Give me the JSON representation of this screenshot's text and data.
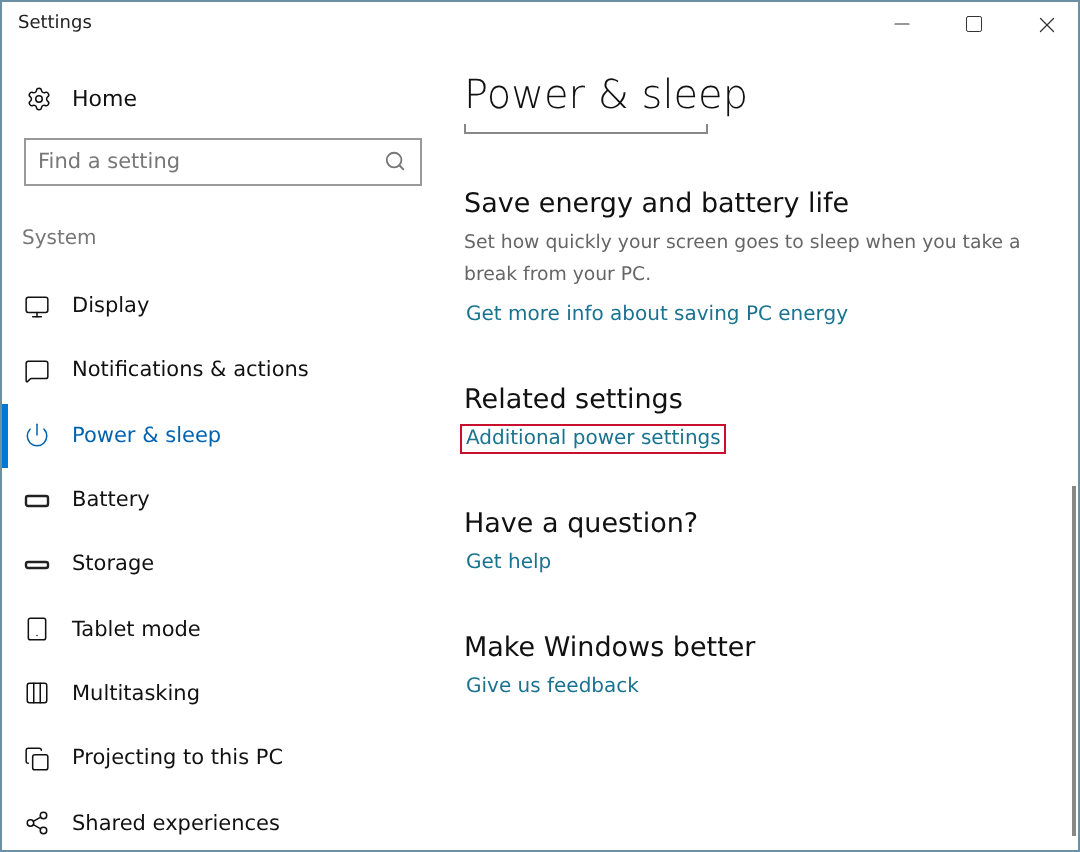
{
  "window": {
    "title": "Settings"
  },
  "sidebar": {
    "home": "Home",
    "search": {
      "placeholder": "Find a setting"
    },
    "section": "System",
    "items": [
      {
        "label": "Display",
        "selected": false
      },
      {
        "label": "Notifications & actions",
        "selected": false
      },
      {
        "label": "Power & sleep",
        "selected": true
      },
      {
        "label": "Battery",
        "selected": false
      },
      {
        "label": "Storage",
        "selected": false
      },
      {
        "label": "Tablet mode",
        "selected": false
      },
      {
        "label": "Multitasking",
        "selected": false
      },
      {
        "label": "Projecting to this PC",
        "selected": false
      },
      {
        "label": "Shared experiences",
        "selected": false
      }
    ]
  },
  "content": {
    "title": "Power & sleep",
    "sections": [
      {
        "heading": "Save energy and battery life",
        "description": "Set how quickly your screen goes to sleep when you take a break from your PC.",
        "link": "Get more info about saving PC energy",
        "highlighted": false
      },
      {
        "heading": "Related settings",
        "link": "Additional power settings",
        "highlighted": true
      },
      {
        "heading": "Have a question?",
        "link": "Get help",
        "highlighted": false
      },
      {
        "heading": "Make Windows better",
        "link": "Give us feedback",
        "highlighted": false
      }
    ]
  }
}
